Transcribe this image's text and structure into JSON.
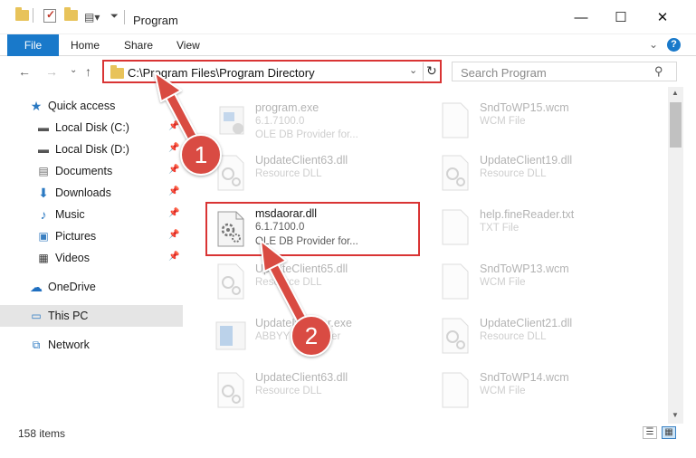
{
  "window": {
    "title": "Program",
    "minimize": "—",
    "maximize": "☐",
    "close": "✕"
  },
  "ribbon": {
    "tabs": [
      "File",
      "Home",
      "Share",
      "View"
    ],
    "expand_icon": "chevron-down-icon",
    "help_label": "?"
  },
  "navigation": {
    "address": "C:\\Program Files\\Program Directory",
    "search_placeholder": "Search Program"
  },
  "sidebar": {
    "items": [
      {
        "label": "Quick access",
        "icon": "star-icon",
        "pinned": false
      },
      {
        "label": "Local Disk (C:)",
        "icon": "drive-icon",
        "pinned": true
      },
      {
        "label": "Local Disk (D:)",
        "icon": "drive-icon",
        "pinned": true
      },
      {
        "label": "Documents",
        "icon": "documents-icon",
        "pinned": true
      },
      {
        "label": "Downloads",
        "icon": "download-icon",
        "pinned": true
      },
      {
        "label": "Music",
        "icon": "music-icon",
        "pinned": true
      },
      {
        "label": "Pictures",
        "icon": "pictures-icon",
        "pinned": true
      },
      {
        "label": "Videos",
        "icon": "videos-icon",
        "pinned": true
      },
      {
        "label": "OneDrive",
        "icon": "cloud-icon",
        "pinned": false
      },
      {
        "label": "This PC",
        "icon": "computer-icon",
        "pinned": false,
        "selected": true
      },
      {
        "label": "Network",
        "icon": "network-icon",
        "pinned": false
      }
    ]
  },
  "files": {
    "left": [
      {
        "name": "program.exe",
        "line1": "6.1.7100.0",
        "line2": "OLE DB Provider for...",
        "kind": "exe"
      },
      {
        "name": "UpdateClient63.dll",
        "line1": "Resource DLL",
        "line2": "",
        "kind": "dll"
      },
      {
        "name": "msdaorar.dll",
        "line1": "6.1.7100.0",
        "line2": "OLE DB Provider for...",
        "kind": "dll",
        "highlighted": true
      },
      {
        "name": "UpdateClient65.dll",
        "line1": "Resource DLL",
        "line2": "",
        "kind": "dll"
      },
      {
        "name": "UpdateInstaller.exe",
        "line1": "ABBYY ... Installer",
        "line2": "",
        "kind": "installer"
      },
      {
        "name": "UpdateClient63.dll",
        "line1": "Resource DLL",
        "line2": "",
        "kind": "dll"
      }
    ],
    "right": [
      {
        "name": "SndToWP15.wcm",
        "line1": "WCM File",
        "kind": "blank"
      },
      {
        "name": "UpdateClient19.dll",
        "line1": "Resource DLL",
        "kind": "dll"
      },
      {
        "name": "help.fineReader.txt",
        "line1": "TXT File",
        "kind": "blank"
      },
      {
        "name": "SndToWP13.wcm",
        "line1": "WCM File",
        "kind": "blank"
      },
      {
        "name": "UpdateClient21.dll",
        "line1": "Resource DLL",
        "kind": "dll"
      },
      {
        "name": "SndToWP14.wcm",
        "line1": "WCM File",
        "kind": "blank"
      }
    ]
  },
  "annotations": {
    "step1": "1",
    "step2": "2",
    "color": "#d94b43"
  },
  "status": {
    "item_count": "158 items"
  }
}
